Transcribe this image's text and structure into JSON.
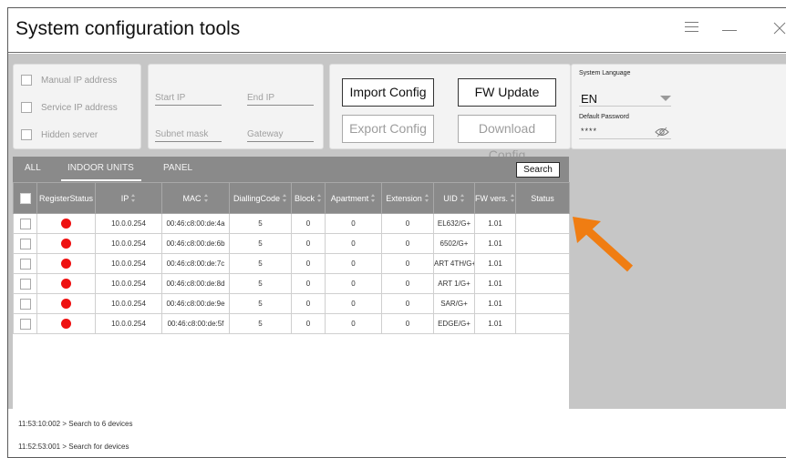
{
  "app": {
    "title": "System configuration tools"
  },
  "window_controls": {
    "menu_icon": "hamburger-icon",
    "minimize_icon": "minimize-icon",
    "close_icon": "close-icon"
  },
  "options": [
    {
      "label": "Manual IP address",
      "checked": false
    },
    {
      "label": "Service IP address",
      "checked": false
    },
    {
      "label": "Hidden server",
      "checked": false
    }
  ],
  "network": {
    "start_ip": "Start IP",
    "end_ip": "End IP",
    "subnet_mask": "Subnet mask",
    "gateway": "Gateway"
  },
  "actions": {
    "import_config": "Import Config",
    "fw_update": "FW Update",
    "export_config": "Export Config",
    "download_config": "Download Config"
  },
  "settings": {
    "language_label": "System Language",
    "language_value": "EN",
    "password_label": "Default Password",
    "password_value": "****"
  },
  "tabs": [
    {
      "label": "ALL",
      "active": false
    },
    {
      "label": "INDOOR UNITS",
      "active": true
    },
    {
      "label": "PANEL",
      "active": false
    }
  ],
  "search_label": "Search",
  "table": {
    "columns": [
      "RegisterStatus",
      "IP",
      "MAC",
      "DiallingCode",
      "Block",
      "Apartment",
      "Extension",
      "UID",
      "FW vers.",
      "Status"
    ],
    "rows": [
      {
        "status_color": "#ee1111",
        "ip": "10.0.0.254",
        "mac": "00:46:c8:00:de:4a",
        "dialling": "5",
        "block": "0",
        "apartment": "0",
        "extension": "0",
        "uid": "EL632/G+",
        "fw": "1.01",
        "status": ""
      },
      {
        "status_color": "#ee1111",
        "ip": "10.0.0.254",
        "mac": "00:46:c8:00:de:6b",
        "dialling": "5",
        "block": "0",
        "apartment": "0",
        "extension": "0",
        "uid": "6502/G+",
        "fw": "1.01",
        "status": ""
      },
      {
        "status_color": "#ee1111",
        "ip": "10.0.0.254",
        "mac": "00:46:c8:00:de:7c",
        "dialling": "5",
        "block": "0",
        "apartment": "0",
        "extension": "0",
        "uid": "ART 4TH/G+",
        "fw": "1.01",
        "status": ""
      },
      {
        "status_color": "#ee1111",
        "ip": "10.0.0.254",
        "mac": "00:46:c8:00:de:8d",
        "dialling": "5",
        "block": "0",
        "apartment": "0",
        "extension": "0",
        "uid": "ART 1/G+",
        "fw": "1.01",
        "status": ""
      },
      {
        "status_color": "#ee1111",
        "ip": "10.0.0.254",
        "mac": "00:46:c8:00:de:9e",
        "dialling": "5",
        "block": "0",
        "apartment": "0",
        "extension": "0",
        "uid": "SAR/G+",
        "fw": "1.01",
        "status": ""
      },
      {
        "status_color": "#ee1111",
        "ip": "10.0.0.254",
        "mac": "00:46:c8:00:de:5f",
        "dialling": "5",
        "block": "0",
        "apartment": "0",
        "extension": "0",
        "uid": "EDGE/G+",
        "fw": "1.01",
        "status": ""
      }
    ]
  },
  "log": [
    "11:53:10:002 > Search to 6 devices",
    "11:52:53:001 > Search for devices"
  ],
  "colors": {
    "arrow": "#f07d12",
    "status_red": "#ee1111",
    "header_grey": "#8a8a8a"
  }
}
